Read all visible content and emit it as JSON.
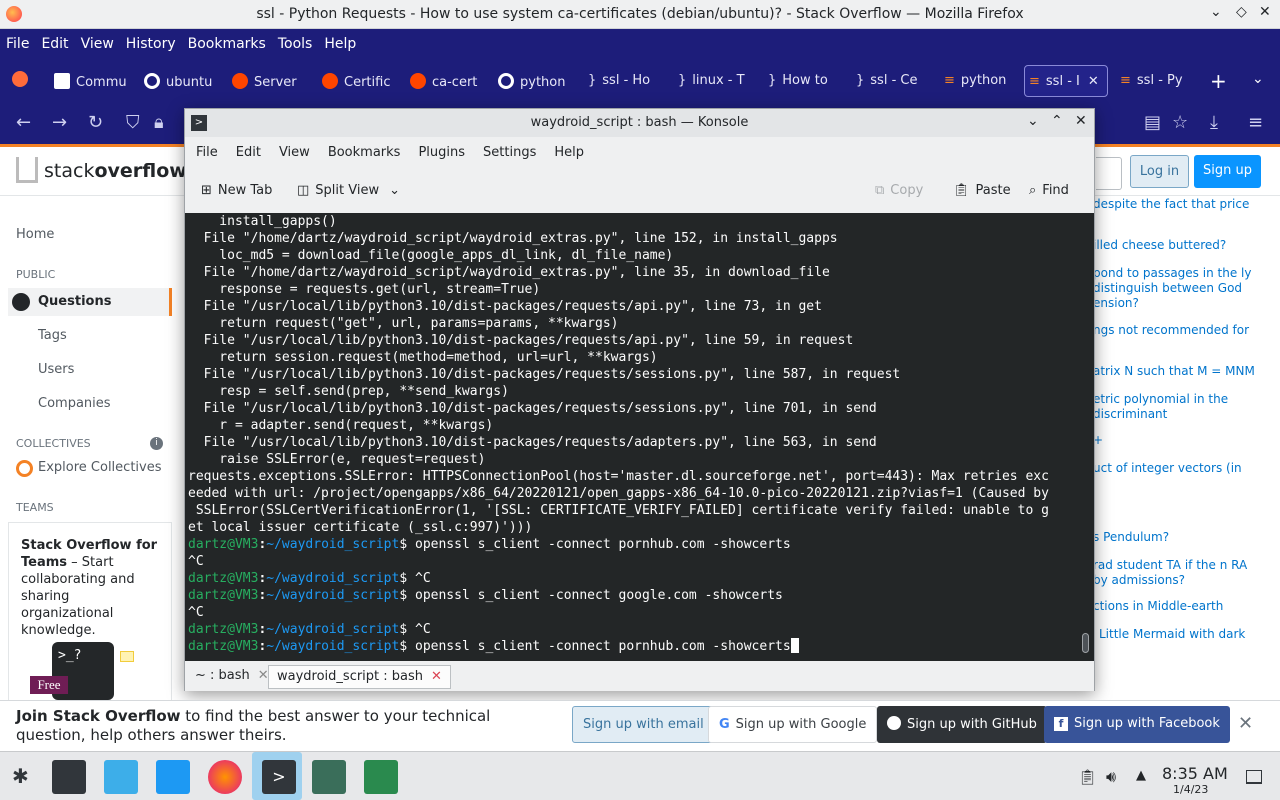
{
  "firefox": {
    "window_title": "ssl - Python Requests - How to use system ca-certificates (debian/ubuntu)? - Stack Overflow — Mozilla Firefox",
    "menu": [
      "File",
      "Edit",
      "View",
      "History",
      "Bookmarks",
      "Tools",
      "Help"
    ],
    "tabs": [
      "Commu",
      "ubuntu",
      "Server",
      "Certific",
      "ca-cert",
      "python",
      "ssl - Ho",
      "linux - T",
      "How to",
      "ssl - Ce",
      "python",
      "ssl - I",
      "ssl - Py"
    ]
  },
  "so": {
    "logo_a": "stack",
    "logo_b": "overflow",
    "login": "Log in",
    "signup": "Sign up",
    "nav": {
      "home": "Home",
      "public": "PUBLIC",
      "questions": "Questions",
      "tags": "Tags",
      "users": "Users",
      "companies": "Companies",
      "collectives": "COLLECTIVES",
      "explore": "Explore Collectives",
      "teams": "TEAMS"
    },
    "teams_box": {
      "title": "Stack Overflow for Teams",
      "text": " – Start collaborating and sharing organizational knowledge.",
      "free": "Free"
    },
    "right": [
      "despite the fact that price",
      "illed cheese buttered?",
      "pond to passages in the ly distinguish between God ension?",
      "ngs not recommended for",
      "atrix N such that M = MNM",
      "etric polynomial in the discriminant",
      "+",
      "uct of integer vectors (in",
      "s Pendulum?",
      "rad student TA if the n RA by admissions?",
      "ctions in Middle-earth",
      "Little Mermaid with dark"
    ],
    "banner": {
      "bold": "Join Stack Overflow",
      "text": " to find the best answer to your technical question, help others answer theirs.",
      "email": "Sign up with email",
      "google": "Sign up with Google",
      "github": "Sign up with GitHub",
      "facebook": "Sign up with Facebook"
    }
  },
  "konsole": {
    "title": "waydroid_script : bash — Konsole",
    "menu": [
      "File",
      "Edit",
      "View",
      "Bookmarks",
      "Plugins",
      "Settings",
      "Help"
    ],
    "toolbar": {
      "new_tab": "New Tab",
      "split_view": "Split View",
      "copy": "Copy",
      "paste": "Paste",
      "find": "Find"
    },
    "lines": [
      "    install_gapps()",
      "  File \"/home/dartz/waydroid_script/waydroid_extras.py\", line 152, in install_gapps",
      "    loc_md5 = download_file(google_apps_dl_link, dl_file_name)",
      "  File \"/home/dartz/waydroid_script/waydroid_extras.py\", line 35, in download_file",
      "    response = requests.get(url, stream=True)",
      "  File \"/usr/local/lib/python3.10/dist-packages/requests/api.py\", line 73, in get",
      "    return request(\"get\", url, params=params, **kwargs)",
      "  File \"/usr/local/lib/python3.10/dist-packages/requests/api.py\", line 59, in request",
      "    return session.request(method=method, url=url, **kwargs)",
      "  File \"/usr/local/lib/python3.10/dist-packages/requests/sessions.py\", line 587, in request",
      "    resp = self.send(prep, **send_kwargs)",
      "  File \"/usr/local/lib/python3.10/dist-packages/requests/sessions.py\", line 701, in send",
      "    r = adapter.send(request, **kwargs)",
      "  File \"/usr/local/lib/python3.10/dist-packages/requests/adapters.py\", line 563, in send",
      "    raise SSLError(e, request=request)",
      "requests.exceptions.SSLError: HTTPSConnectionPool(host='master.dl.sourceforge.net', port=443): Max retries exc",
      "eeded with url: /project/opengapps/x86_64/20220121/open_gapps-x86_64-10.0-pico-20220121.zip?viasf=1 (Caused by",
      " SSLError(SSLCertVerificationError(1, '[SSL: CERTIFICATE_VERIFY_FAILED] certificate verify failed: unable to g",
      "et local issuer certificate (_ssl.c:997)')))"
    ],
    "prompt_user": "dartz@VM3",
    "prompt_path": "~/waydroid_script",
    "cmds": [
      {
        "c": " openssl s_client -connect pornhub.com -showcerts",
        "o": "^C"
      },
      {
        "c": " ^C",
        "o": ""
      },
      {
        "c": " openssl s_client -connect google.com -showcerts",
        "o": "^C"
      },
      {
        "c": " ^C",
        "o": ""
      },
      {
        "c": " openssl s_client -connect pornhub.com -showcerts",
        "o": ""
      }
    ],
    "tabs": [
      "~ : bash",
      "waydroid_script : bash"
    ]
  },
  "taskbar": {
    "time": "8:35 AM",
    "date": "1/4/23"
  }
}
